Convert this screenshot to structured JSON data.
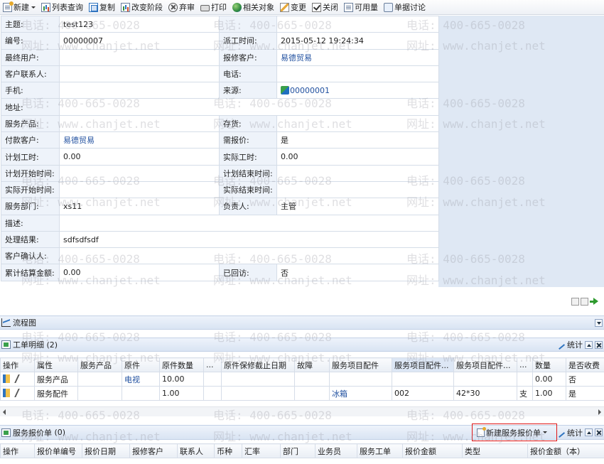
{
  "toolbar": {
    "new": "新建",
    "list_query": "列表查询",
    "copy": "复制",
    "change_stage": "改变阶段",
    "abandon": "弃审",
    "print": "打印",
    "related": "相关对象",
    "change": "变更",
    "close": "关闭",
    "available": "可用量",
    "discuss": "单据讨论"
  },
  "form": {
    "subject_label": "主题:",
    "subject": "test123",
    "number_label": "编号:",
    "number": "00000007",
    "dispatch_time_label": "派工时间:",
    "dispatch_time": "2015-05-12 19:24:34",
    "end_user_label": "最终用户:",
    "repair_customer_label": "报修客户:",
    "repair_customer": "易德贸易",
    "contact_label": "客户联系人:",
    "phone_label": "电话:",
    "mobile_label": "手机:",
    "source_label": "来源:",
    "source": "00000001",
    "address_label": "地址:",
    "service_product_label": "服务产品:",
    "stock_label": "存货:",
    "payer_label": "付款客户:",
    "payer": "易德贸易",
    "need_quote_label": "需报价:",
    "need_quote": "是",
    "plan_hours_label": "计划工时:",
    "plan_hours": "0.00",
    "actual_hours_label": "实际工时:",
    "actual_hours": "0.00",
    "plan_start_label": "计划开始时间:",
    "plan_end_label": "计划结束时间:",
    "actual_start_label": "实际开始时间:",
    "actual_end_label": "实际结束时间:",
    "dept_label": "服务部门:",
    "dept": "xs11",
    "owner_label": "负责人:",
    "owner": "主管",
    "desc_label": "描述:",
    "result_label": "处理结果:",
    "result": "sdfsdfsdf",
    "confirm_label": "客户确认人:",
    "total_label": "累计结算金额:",
    "total": "0.00",
    "visited_label": "已回访:",
    "visited": "否"
  },
  "watermark": {
    "phone": "电话: 400-665-0028",
    "site": "网址: www.chanjet.net"
  },
  "sections": {
    "flow": "流程图",
    "detail": "工单明细",
    "detail_count": "(2)",
    "quote": "服务报价单",
    "quote_count": "(0)",
    "stats": "统计",
    "new_quote": "新建服务报价单"
  },
  "detail_table": {
    "headers": [
      "操作",
      "属性",
      "服务产品",
      "原件",
      "原件数量",
      "...",
      "原件保修截止日期",
      "故障",
      "服务项目配件",
      "服务项目配件...",
      "服务项目配件...",
      "...",
      "数量",
      "是否收费"
    ],
    "rows": [
      [
        "",
        "服务产品",
        "",
        "电视",
        "10.00",
        "",
        "",
        "",
        "",
        "",
        "",
        "",
        "0.00",
        "否"
      ],
      [
        "",
        "服务配件",
        "",
        "",
        "1.00",
        "",
        "",
        "",
        "冰箱",
        "002",
        "42*30",
        "支",
        "1.00",
        "是"
      ]
    ]
  },
  "quote_table": {
    "headers": [
      "操作",
      "报价单编号",
      "报价日期",
      "报修客户",
      "联系人",
      "币种",
      "汇率",
      "部门",
      "业务员",
      "服务工单",
      "报价金额",
      "类型",
      "报价金额（本）"
    ]
  }
}
